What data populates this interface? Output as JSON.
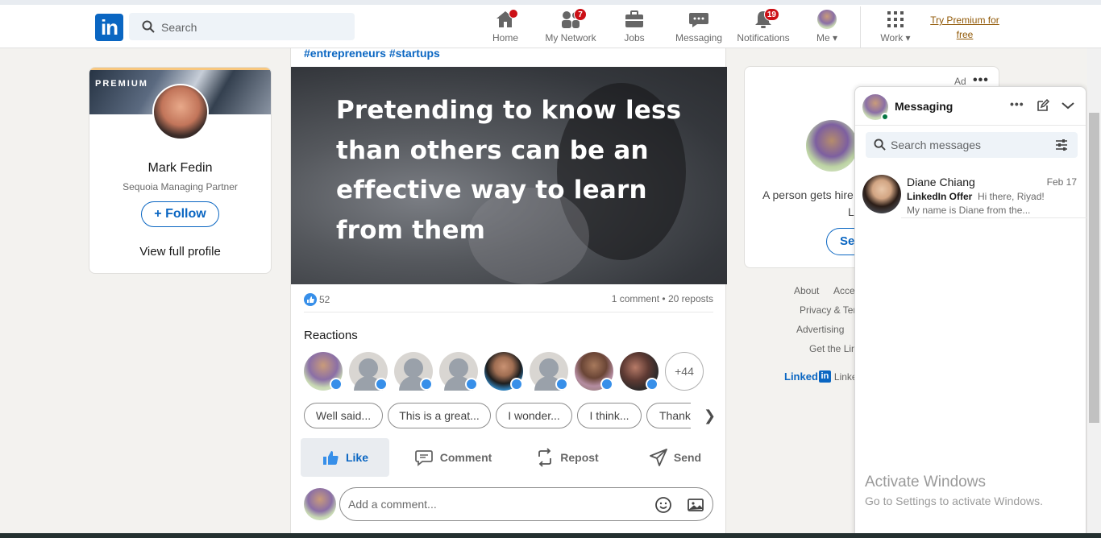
{
  "nav": {
    "logo_text": "in",
    "search_placeholder": "Search",
    "items": [
      {
        "label": "Home",
        "badge": ""
      },
      {
        "label": "My Network",
        "badge": "7"
      },
      {
        "label": "Jobs",
        "badge": ""
      },
      {
        "label": "Messaging",
        "badge": ""
      },
      {
        "label": "Notifications",
        "badge": "19"
      },
      {
        "label": "Me",
        "badge": ""
      },
      {
        "label": "Work",
        "badge": ""
      }
    ],
    "premium_link": "Try Premium for free",
    "icons": [
      "home-icon",
      "my-network-icon",
      "jobs-icon",
      "messaging-icon",
      "notifications-icon",
      "me-avatar",
      "work-grid-icon"
    ]
  },
  "profile_card": {
    "premium_label": "PREMIUM",
    "name": "Mark Fedin",
    "title": "Sequoia Managing Partner",
    "follow_label": "Follow",
    "view_profile": "View full profile"
  },
  "post": {
    "hashtags": "#entrepreneurs #startups",
    "quote": "Pretending to know less than others can be an effective way to learn from them",
    "likes_count": "52",
    "comments_reposts": "1 comment • 20 reposts",
    "reactions_heading": "Reactions",
    "more_reactors": "+44",
    "suggestion_chips": [
      "Well said...",
      "This is a great...",
      "I wonder...",
      "I think...",
      "Thank"
    ],
    "actions": [
      "Like",
      "Comment",
      "Repost",
      "Send"
    ],
    "comment_placeholder": "Add a comment..."
  },
  "ad": {
    "label": "Ad",
    "text_line1": "A person gets hire",
    "text_line2": "L",
    "button": "Sea"
  },
  "footer": {
    "links": [
      "About",
      "Acces",
      "Privacy & Ter",
      "Advertising",
      "Get the Lin"
    ],
    "brand": "Linked",
    "brand_in": "in",
    "brand_rest": "Linke"
  },
  "messaging": {
    "title": "Messaging",
    "search_placeholder": "Search messages",
    "conversations": [
      {
        "name": "Diane Chiang",
        "date": "Feb 17",
        "sender_tag": "LinkedIn Offer",
        "preview1": "Hi there, Riyad!",
        "preview2": "My name is Diane from the..."
      }
    ]
  },
  "system": {
    "activate_title": "Activate Windows",
    "activate_sub": "Go to Settings to activate Windows."
  },
  "colors": {
    "brand_blue": "#0a66c2",
    "badge_red": "#cc1016",
    "premium_gold": "#915907",
    "online_green": "#057642"
  }
}
